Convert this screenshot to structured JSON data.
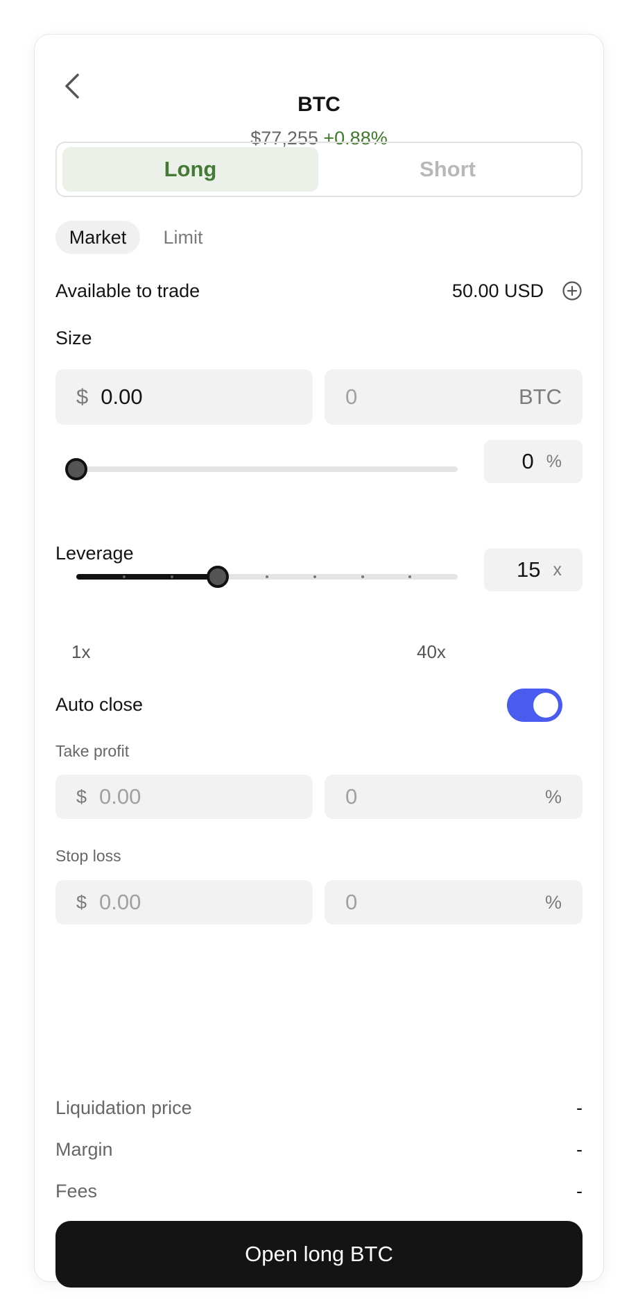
{
  "header": {
    "back_icon": "chevron-left-icon",
    "title": "BTC",
    "price": "$77,255",
    "change": "+0.88%",
    "change_color": "#3d7a2a"
  },
  "side": {
    "long_label": "Long",
    "short_label": "Short",
    "selected": "Long"
  },
  "order_type": {
    "market_label": "Market",
    "limit_label": "Limit",
    "selected": "Market"
  },
  "available": {
    "label": "Available to trade",
    "value": "50.00 USD",
    "icon": "plus-circle-icon"
  },
  "size": {
    "label": "Size",
    "usd_symbol": "$",
    "usd_value": "0.00",
    "btc_value": "0",
    "btc_unit": "BTC",
    "percent_value": "0",
    "percent_unit": "%",
    "slider_fraction": 0
  },
  "leverage": {
    "label": "Leverage",
    "value": "15",
    "unit": "x",
    "min_label": "1x",
    "max_label": "40x",
    "slider_fraction": 0.37,
    "tick_count": 9
  },
  "auto_close": {
    "label": "Auto close",
    "enabled": true,
    "switch_color": "#4a5cf0",
    "take_profit": {
      "label": "Take profit",
      "usd_symbol": "$",
      "price_placeholder": "0.00",
      "percent_placeholder": "0",
      "percent_unit": "%"
    },
    "stop_loss": {
      "label": "Stop loss",
      "usd_symbol": "$",
      "price_placeholder": "0.00",
      "percent_placeholder": "0",
      "percent_unit": "%"
    }
  },
  "summary": {
    "liquidation_label": "Liquidation price",
    "liquidation_value": "-",
    "margin_label": "Margin",
    "margin_value": "-",
    "fees_label": "Fees",
    "fees_value": "-"
  },
  "submit": {
    "label": "Open long BTC"
  },
  "colors": {
    "long_bg": "#ebf1e9",
    "long_text": "#447a36",
    "button_bg": "#141414"
  }
}
